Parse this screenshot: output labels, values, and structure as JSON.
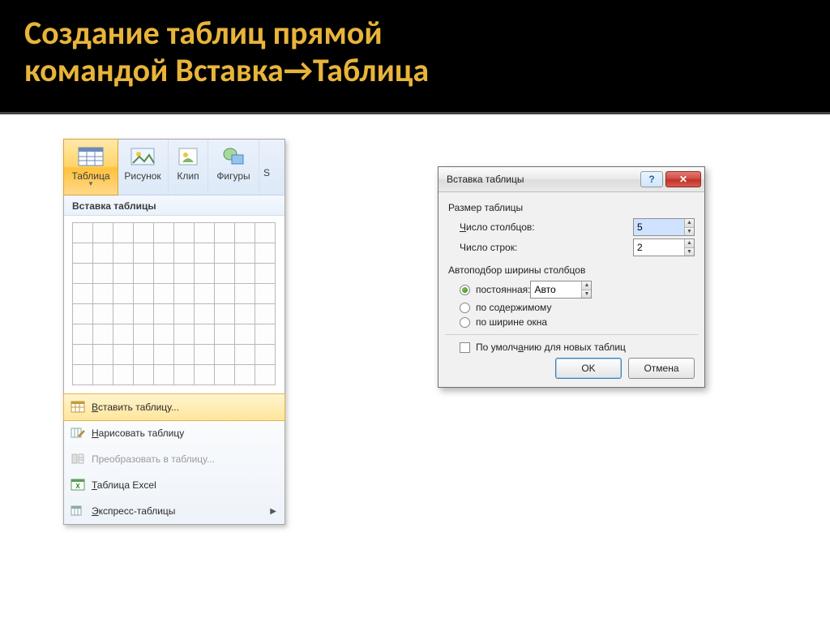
{
  "slide": {
    "title_line1": "Создание таблиц прямой",
    "title_line2": "командой Вставка→Таблица"
  },
  "ribbon": {
    "buttons": {
      "table": "Таблица",
      "picture": "Рисунок",
      "clip": "Клип",
      "shapes": "Фигуры",
      "smart": "S"
    },
    "grid_header": "Вставка таблицы",
    "grid_cols": 10,
    "grid_rows": 8,
    "menu": {
      "insert_table": "Вставить таблицу...",
      "draw_table": "Нарисовать таблицу",
      "convert": "Преобразовать в таблицу...",
      "excel": "Таблица Excel",
      "quick": "Экспресс-таблицы"
    }
  },
  "dialog": {
    "title": "Вставка таблицы",
    "group_size": "Размер таблицы",
    "cols_label": "Число столбцов:",
    "cols_value": "5",
    "rows_label": "Число строк:",
    "rows_value": "2",
    "group_autofit": "Автоподбор ширины столбцов",
    "fixed_label": "постоянная:",
    "fixed_value": "Авто",
    "fit_content": "по содержимому",
    "fit_window": "по ширине окна",
    "remember": "По умолчанию для новых таблиц",
    "ok": "OK",
    "cancel": "Отмена",
    "help_glyph": "?",
    "close_glyph": "✕"
  }
}
